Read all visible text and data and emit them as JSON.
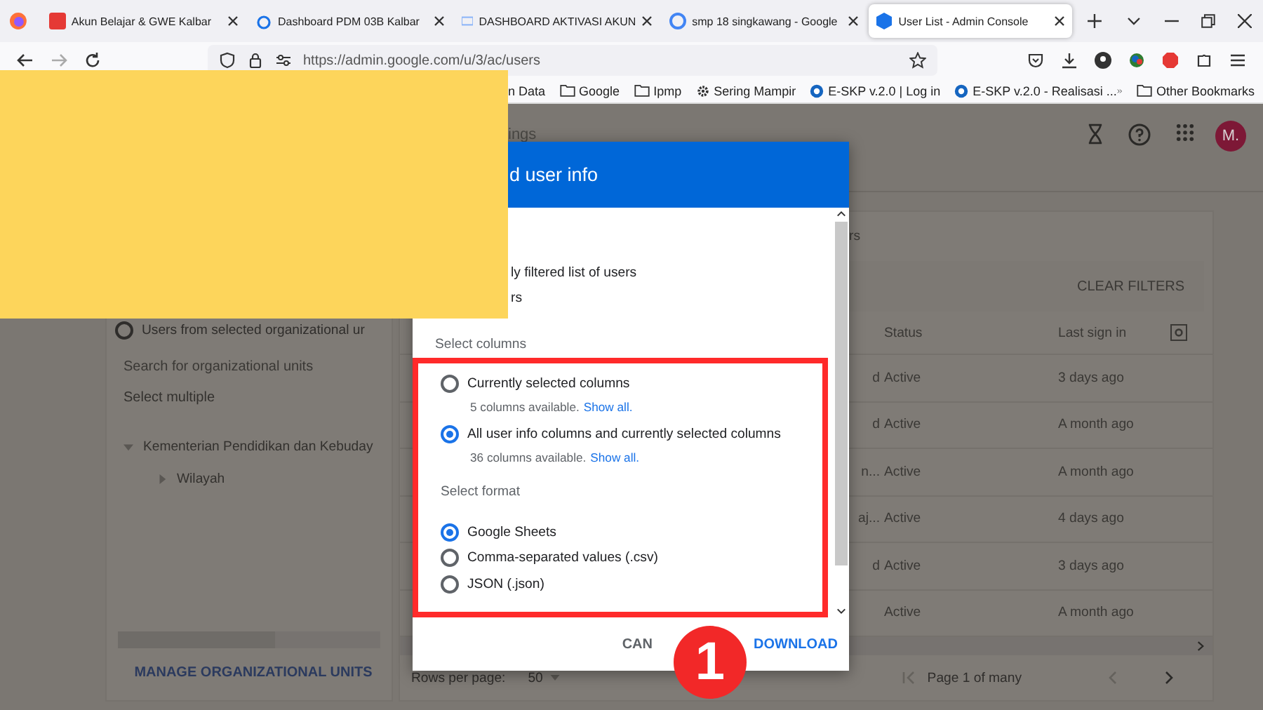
{
  "browser": {
    "tabs": [
      {
        "title": "Akun Belajar & GWE Kalbar",
        "selected": false
      },
      {
        "title": "Dashboard PDM 03B Kalbar",
        "selected": false
      },
      {
        "title": "DASHBOARD AKTIVASI AKUN",
        "selected": false
      },
      {
        "title": "smp 18 singkawang - Google",
        "selected": false
      },
      {
        "title": "User List - Admin Console",
        "selected": true
      }
    ],
    "url": "https://admin.google.com/u/3/ac/users",
    "bookmarks": [
      {
        "label": "n Data",
        "kind": "plain"
      },
      {
        "label": "Google",
        "kind": "folder"
      },
      {
        "label": "Ipmp",
        "kind": "folder"
      },
      {
        "label": "Sering Mampir",
        "kind": "gear"
      },
      {
        "label": "E-SKP v.2.0 | Log in",
        "kind": "site"
      },
      {
        "label": "E-SKP v.2.0 - Realisasi ...",
        "kind": "site"
      }
    ],
    "other_bookmarks": "Other Bookmarks"
  },
  "header": {
    "breadcrumb": "ings",
    "avatar": "M."
  },
  "org_panel": {
    "scope_option": {
      "label": "Users from selected organizational ur",
      "selected": false
    },
    "search_placeholder": "Search for organizational units",
    "select_multiple": "Select multiple",
    "tree": [
      {
        "label": "Kementerian Pendidikan dan Kebuday",
        "expanded": true,
        "children": [
          {
            "label": "Wilayah",
            "expanded": false
          }
        ]
      }
    ],
    "manage_link": "MANAGE ORGANIZATIONAL UNITS"
  },
  "table": {
    "filter_text": "rs",
    "clear_filters": "CLEAR FILTERS",
    "columns": [
      "Status",
      "Last sign in"
    ],
    "rows": [
      {
        "column_1": "d",
        "status": "Active",
        "last_sign_in": "3 days ago"
      },
      {
        "column_1": "d",
        "status": "Active",
        "last_sign_in": "A month ago"
      },
      {
        "column_1": "n...",
        "status": "Active",
        "last_sign_in": "A month ago"
      },
      {
        "column_1": "aj...",
        "status": "Active",
        "last_sign_in": "4 days ago"
      },
      {
        "column_1": "d",
        "status": "Active",
        "last_sign_in": "3 days ago"
      },
      {
        "status": "Active",
        "last_sign_in": "A month ago"
      }
    ],
    "rows_per_page_label": "Rows per page:",
    "rows_per_page": "50",
    "pagination": "Page 1 of many"
  },
  "dialog": {
    "title": "d user info",
    "scope_options": [
      "ly filtered list of users",
      "rs"
    ],
    "columns_heading": "Select columns",
    "column_options": [
      {
        "label": "Currently selected columns",
        "count": "5 columns available.",
        "link": "Show all.",
        "selected": false
      },
      {
        "label": "All user info columns and currently selected columns",
        "count": "36 columns available.",
        "link": "Show all.",
        "selected": true
      }
    ],
    "format_heading": "Select format",
    "format_options": [
      {
        "label": "Google Sheets",
        "selected": true
      },
      {
        "label": "Comma-separated values (.csv)",
        "selected": false
      },
      {
        "label": "JSON (.json)",
        "selected": false
      }
    ],
    "cancel": "CAN",
    "download": "DOWNLOAD"
  },
  "callout": {
    "number": "1"
  }
}
